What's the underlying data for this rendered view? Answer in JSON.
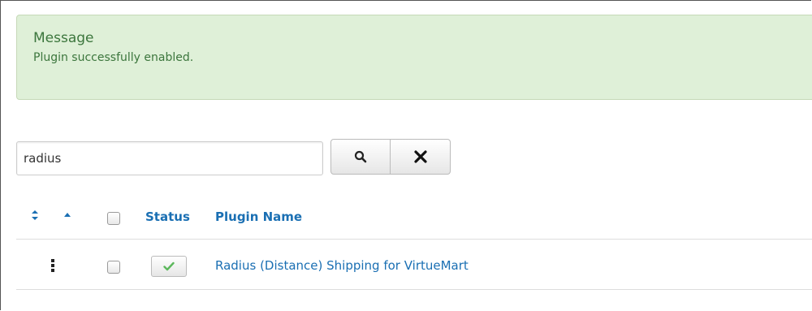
{
  "message": {
    "heading": "Message",
    "text": "Plugin successfully enabled."
  },
  "search": {
    "value": "radius",
    "search_icon": "search-icon",
    "clear_icon": "close-icon"
  },
  "table": {
    "headers": {
      "ordering_icon": "sort-arrows-icon",
      "sort_asc_icon": "caret-up-icon",
      "status": "Status",
      "plugin_name": "Plugin Name"
    },
    "rows": [
      {
        "drag_icon": "drag-handle-icon",
        "status_icon": "check-icon",
        "name": "Radius (Distance) Shipping for VirtueMart"
      }
    ]
  },
  "colors": {
    "link": "#1a6fb3",
    "success_bg": "#dff0d8",
    "success_text": "#3c763d",
    "check": "#5cb85c"
  }
}
